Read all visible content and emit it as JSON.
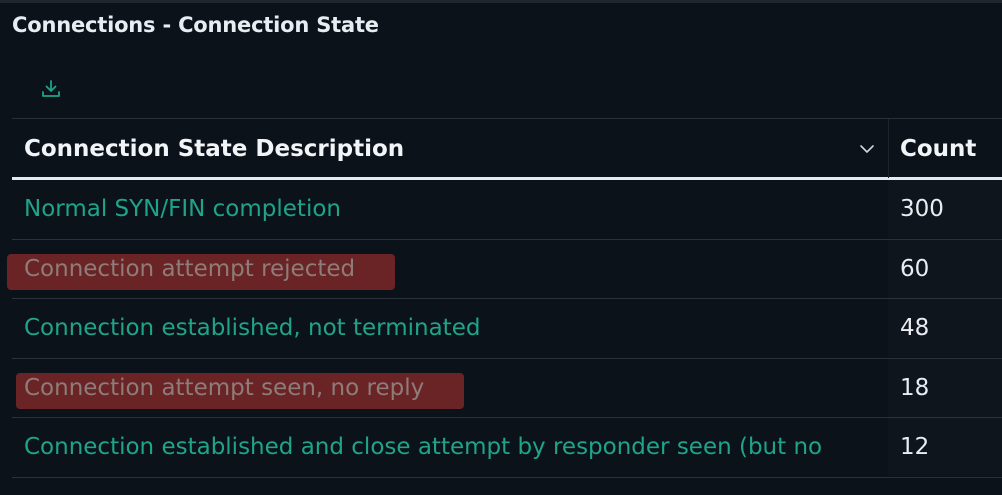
{
  "panel": {
    "title": "Connections - Connection State"
  },
  "toolbar": {
    "download_icon": "download-icon"
  },
  "table": {
    "columns": {
      "description": "Connection State Description",
      "count": "Count"
    },
    "sort_icon": "chevron-down-icon",
    "rows": [
      {
        "description": "Normal SYN/FIN completion",
        "count": "300",
        "flagged": false
      },
      {
        "description": "Connection attempt rejected",
        "count": "60",
        "flagged": true
      },
      {
        "description": "Connection established, not terminated",
        "count": "48",
        "flagged": false
      },
      {
        "description": "Connection attempt seen, no reply",
        "count": "18",
        "flagged": true
      },
      {
        "description": "Connection established and close attempt by responder seen (but no",
        "count": "12",
        "flagged": false
      }
    ]
  },
  "colors": {
    "link": "#1fa48a",
    "flag_highlight": "#6b2426",
    "background": "#0c121a"
  }
}
